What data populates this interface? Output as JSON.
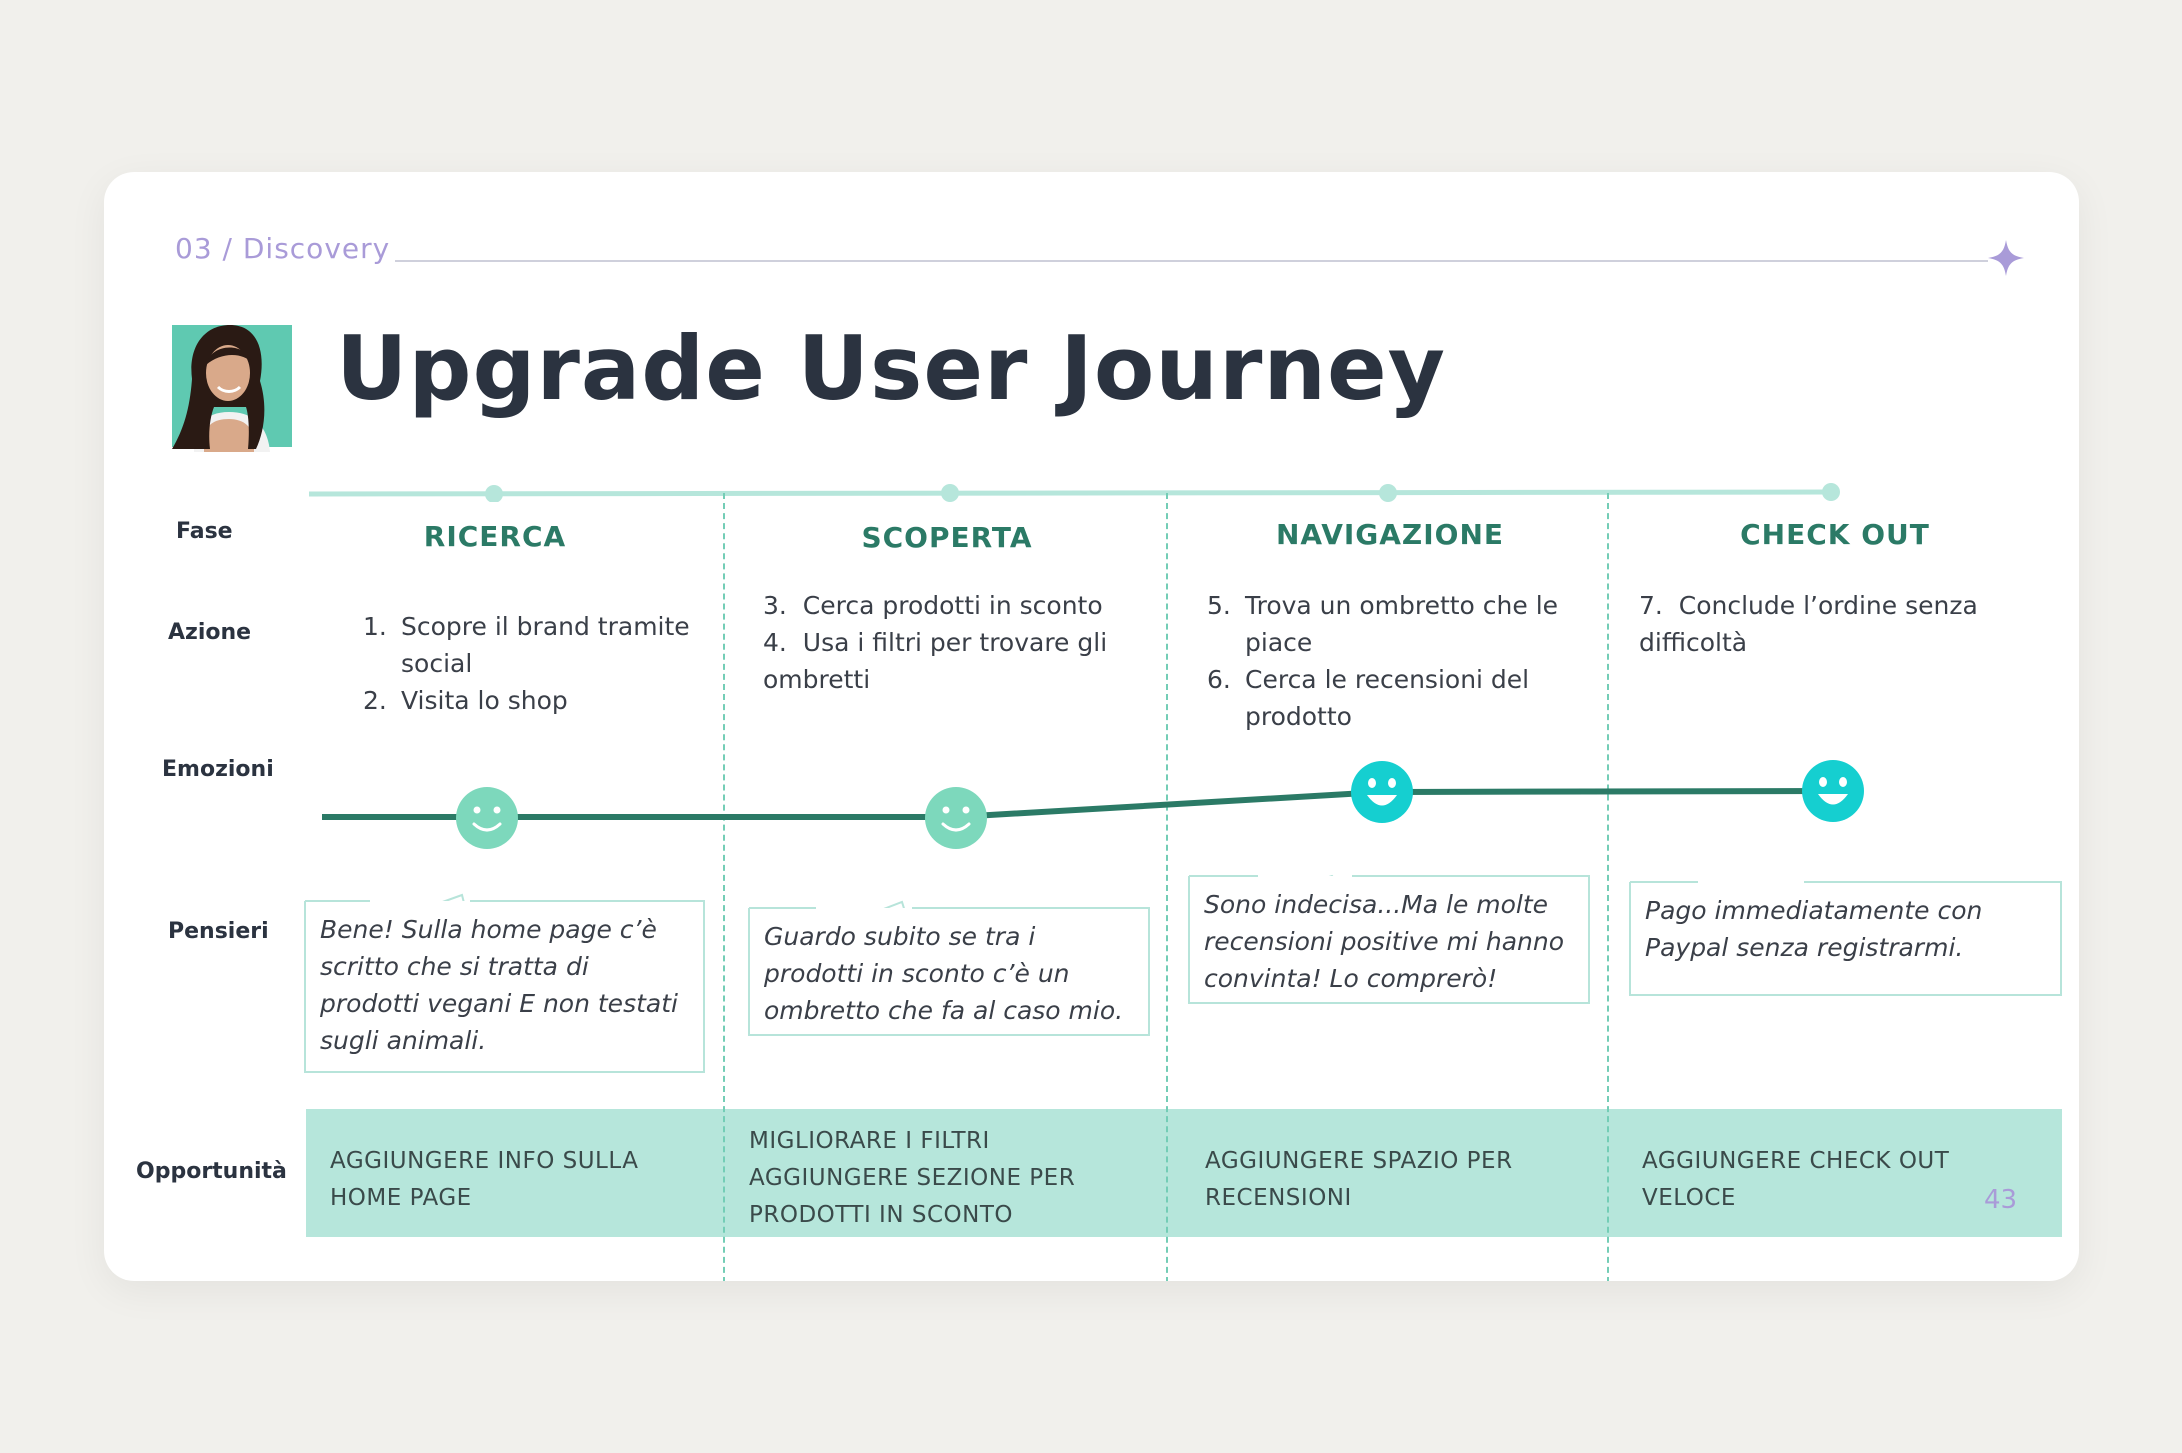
{
  "header": {
    "section": "03 / Discovery",
    "title": "Upgrade User Journey",
    "page_number": "43"
  },
  "row_labels": {
    "phase": "Fase",
    "action": "Azione",
    "emotions": "Emozioni",
    "thoughts": "Pensieri",
    "opportunities": "Opportunità"
  },
  "phases": [
    {
      "name": "RICERCA",
      "actions": [
        {
          "num": "1.",
          "text": "Scopre il brand tramite social"
        },
        {
          "num": "2.",
          "text": "Visita lo shop"
        }
      ],
      "emotion": "smile",
      "thought": "Bene! Sulla home page c’è scritto che si tratta di prodotti vegani E non testati sugli animali.",
      "opportunity": "AGGIUNGERE INFO SULLA HOME PAGE"
    },
    {
      "name": "SCOPERTA",
      "actions": [
        {
          "num": "3.",
          "text": "Cerca prodotti in sconto"
        },
        {
          "num": "4.",
          "text": "Usa i filtri per trovare gli ombretti"
        }
      ],
      "emotion": "smile",
      "thought": "Guardo subito se tra i prodotti in sconto c’è un ombretto che fa al caso mio.",
      "opportunity_lines": [
        "MIGLIORARE I FILTRI",
        "AGGIUNGERE SEZIONE PER PRODOTTI IN SCONTO"
      ]
    },
    {
      "name": "NAVIGAZIONE",
      "actions": [
        {
          "num": "5.",
          "text": "Trova un ombretto che le piace"
        },
        {
          "num": "6.",
          "text": "Cerca le recensioni del prodotto"
        }
      ],
      "emotion": "happy",
      "thought": "Sono indecisa...Ma le molte recensioni positive mi hanno convinta! Lo comprerò!",
      "opportunity": "AGGIUNGERE SPAZIO PER RECENSIONI"
    },
    {
      "name": "CHECK OUT",
      "actions": [
        {
          "num": "7.",
          "text": "Conclude l’ordine senza difficoltà"
        }
      ],
      "emotion": "happy",
      "thought": "Pago immediatamente con Paypal senza registrarmi.",
      "opportunity": "AGGIUNGERE CHECK OUT VELOCE"
    }
  ],
  "emotion_levels": [
    0.3,
    0.3,
    1.0,
    1.0
  ],
  "colors": {
    "title": "#2b3340",
    "phase": "#2b7a66",
    "timeline": "#b6e6db",
    "emotion_line": "#2b7a66",
    "smile_face": "#7dd8bc",
    "happy_face": "#15cfd0",
    "opportunity_band": "#b6e6db",
    "accent": "#a99bd8"
  }
}
